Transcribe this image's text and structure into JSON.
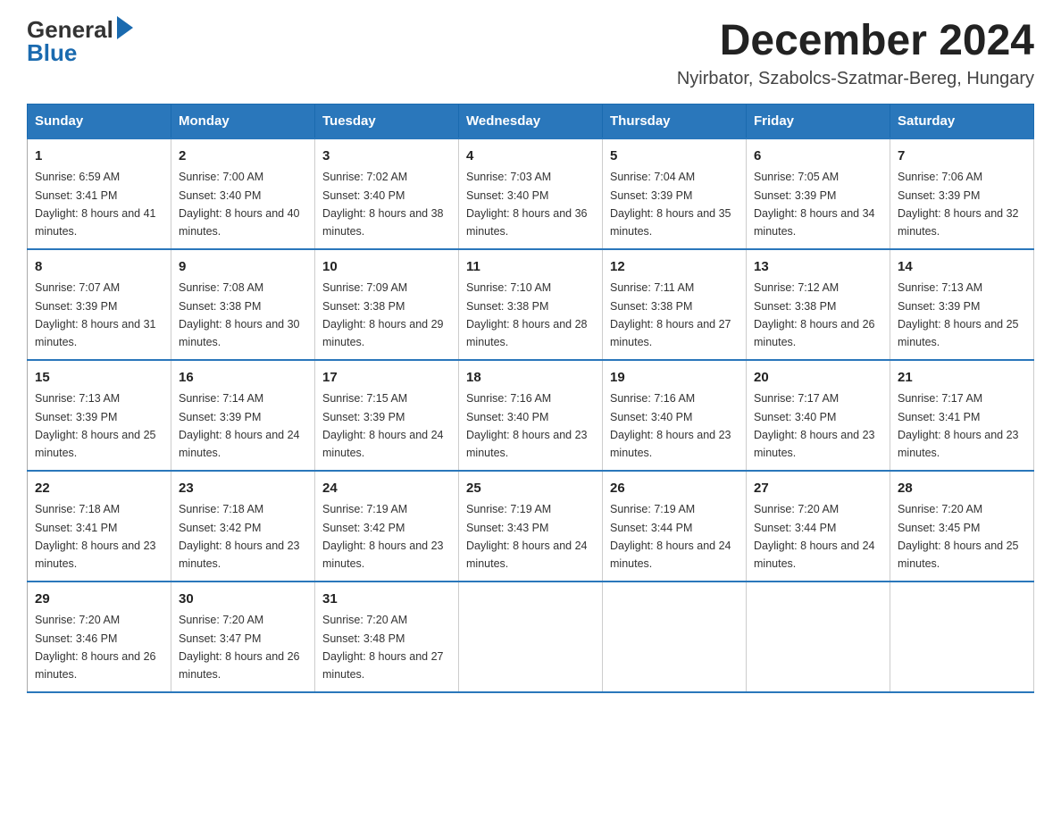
{
  "logo": {
    "general": "General",
    "blue": "Blue",
    "arrow": "▶"
  },
  "title": "December 2024",
  "subtitle": "Nyirbator, Szabolcs-Szatmar-Bereg, Hungary",
  "days": [
    "Sunday",
    "Monday",
    "Tuesday",
    "Wednesday",
    "Thursday",
    "Friday",
    "Saturday"
  ],
  "weeks": [
    [
      {
        "num": "1",
        "sunrise": "6:59 AM",
        "sunset": "3:41 PM",
        "daylight": "8 hours and 41 minutes."
      },
      {
        "num": "2",
        "sunrise": "7:00 AM",
        "sunset": "3:40 PM",
        "daylight": "8 hours and 40 minutes."
      },
      {
        "num": "3",
        "sunrise": "7:02 AM",
        "sunset": "3:40 PM",
        "daylight": "8 hours and 38 minutes."
      },
      {
        "num": "4",
        "sunrise": "7:03 AM",
        "sunset": "3:40 PM",
        "daylight": "8 hours and 36 minutes."
      },
      {
        "num": "5",
        "sunrise": "7:04 AM",
        "sunset": "3:39 PM",
        "daylight": "8 hours and 35 minutes."
      },
      {
        "num": "6",
        "sunrise": "7:05 AM",
        "sunset": "3:39 PM",
        "daylight": "8 hours and 34 minutes."
      },
      {
        "num": "7",
        "sunrise": "7:06 AM",
        "sunset": "3:39 PM",
        "daylight": "8 hours and 32 minutes."
      }
    ],
    [
      {
        "num": "8",
        "sunrise": "7:07 AM",
        "sunset": "3:39 PM",
        "daylight": "8 hours and 31 minutes."
      },
      {
        "num": "9",
        "sunrise": "7:08 AM",
        "sunset": "3:38 PM",
        "daylight": "8 hours and 30 minutes."
      },
      {
        "num": "10",
        "sunrise": "7:09 AM",
        "sunset": "3:38 PM",
        "daylight": "8 hours and 29 minutes."
      },
      {
        "num": "11",
        "sunrise": "7:10 AM",
        "sunset": "3:38 PM",
        "daylight": "8 hours and 28 minutes."
      },
      {
        "num": "12",
        "sunrise": "7:11 AM",
        "sunset": "3:38 PM",
        "daylight": "8 hours and 27 minutes."
      },
      {
        "num": "13",
        "sunrise": "7:12 AM",
        "sunset": "3:38 PM",
        "daylight": "8 hours and 26 minutes."
      },
      {
        "num": "14",
        "sunrise": "7:13 AM",
        "sunset": "3:39 PM",
        "daylight": "8 hours and 25 minutes."
      }
    ],
    [
      {
        "num": "15",
        "sunrise": "7:13 AM",
        "sunset": "3:39 PM",
        "daylight": "8 hours and 25 minutes."
      },
      {
        "num": "16",
        "sunrise": "7:14 AM",
        "sunset": "3:39 PM",
        "daylight": "8 hours and 24 minutes."
      },
      {
        "num": "17",
        "sunrise": "7:15 AM",
        "sunset": "3:39 PM",
        "daylight": "8 hours and 24 minutes."
      },
      {
        "num": "18",
        "sunrise": "7:16 AM",
        "sunset": "3:40 PM",
        "daylight": "8 hours and 23 minutes."
      },
      {
        "num": "19",
        "sunrise": "7:16 AM",
        "sunset": "3:40 PM",
        "daylight": "8 hours and 23 minutes."
      },
      {
        "num": "20",
        "sunrise": "7:17 AM",
        "sunset": "3:40 PM",
        "daylight": "8 hours and 23 minutes."
      },
      {
        "num": "21",
        "sunrise": "7:17 AM",
        "sunset": "3:41 PM",
        "daylight": "8 hours and 23 minutes."
      }
    ],
    [
      {
        "num": "22",
        "sunrise": "7:18 AM",
        "sunset": "3:41 PM",
        "daylight": "8 hours and 23 minutes."
      },
      {
        "num": "23",
        "sunrise": "7:18 AM",
        "sunset": "3:42 PM",
        "daylight": "8 hours and 23 minutes."
      },
      {
        "num": "24",
        "sunrise": "7:19 AM",
        "sunset": "3:42 PM",
        "daylight": "8 hours and 23 minutes."
      },
      {
        "num": "25",
        "sunrise": "7:19 AM",
        "sunset": "3:43 PM",
        "daylight": "8 hours and 24 minutes."
      },
      {
        "num": "26",
        "sunrise": "7:19 AM",
        "sunset": "3:44 PM",
        "daylight": "8 hours and 24 minutes."
      },
      {
        "num": "27",
        "sunrise": "7:20 AM",
        "sunset": "3:44 PM",
        "daylight": "8 hours and 24 minutes."
      },
      {
        "num": "28",
        "sunrise": "7:20 AM",
        "sunset": "3:45 PM",
        "daylight": "8 hours and 25 minutes."
      }
    ],
    [
      {
        "num": "29",
        "sunrise": "7:20 AM",
        "sunset": "3:46 PM",
        "daylight": "8 hours and 26 minutes."
      },
      {
        "num": "30",
        "sunrise": "7:20 AM",
        "sunset": "3:47 PM",
        "daylight": "8 hours and 26 minutes."
      },
      {
        "num": "31",
        "sunrise": "7:20 AM",
        "sunset": "3:48 PM",
        "daylight": "8 hours and 27 minutes."
      },
      null,
      null,
      null,
      null
    ]
  ]
}
